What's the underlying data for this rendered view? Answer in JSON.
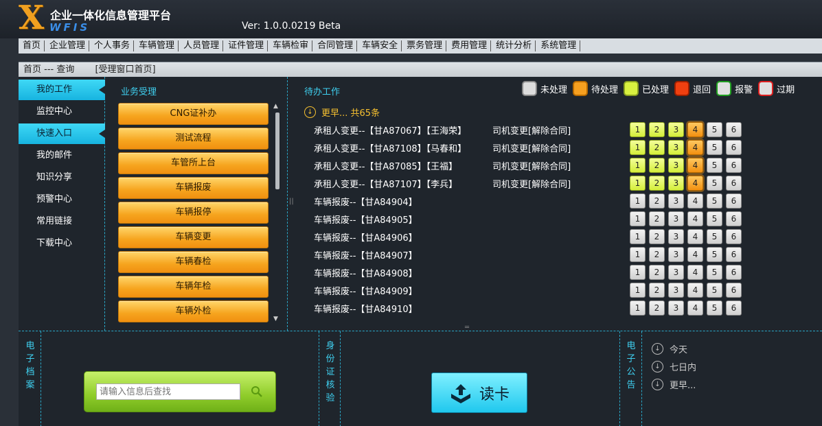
{
  "header": {
    "logo_main": "X",
    "logo_sub": "WFIS",
    "title": "企业一体化信息管理平台",
    "version": "Ver: 1.0.0.0219 Beta"
  },
  "nav": [
    "首页",
    "企业管理",
    "个人事务",
    "车辆管理",
    "人员管理",
    "证件管理",
    "车辆检审",
    "合同管理",
    "车辆安全",
    "票务管理",
    "费用管理",
    "统计分析",
    "系统管理"
  ],
  "breadcrumb": {
    "path": "首页 --- 查询",
    "current": "[受理窗口首页]"
  },
  "left_menu": [
    {
      "label": "我的工作",
      "active": true
    },
    {
      "label": "监控中心",
      "active": false
    },
    {
      "label": "快速入口",
      "active": true
    },
    {
      "label": "我的邮件",
      "active": false
    },
    {
      "label": "知识分享",
      "active": false
    },
    {
      "label": "预警中心",
      "active": false
    },
    {
      "label": "常用链接",
      "active": false
    },
    {
      "label": "下载中心",
      "active": false
    }
  ],
  "business": {
    "title": "业务受理",
    "items": [
      "CNG证补办",
      "测试流程",
      "车管所上台",
      "车辆报废",
      "车辆报停",
      "车辆变更",
      "车辆春检",
      "车辆年检",
      "车辆外检"
    ]
  },
  "todo": {
    "title": "待办工作",
    "legend": [
      {
        "label": "未处理",
        "color": "#dcdcdc",
        "border": "#888888"
      },
      {
        "label": "待处理",
        "color": "#f6a020",
        "border": "#b86a00"
      },
      {
        "label": "已处理",
        "color": "#d8f040",
        "border": "#8aa020"
      },
      {
        "label": "退回",
        "color": "#f04010",
        "border": "#a02000"
      },
      {
        "label": "报警",
        "color": "#e0e0e0",
        "border": "#20a020"
      },
      {
        "label": "过期",
        "color": "#e0e0e0",
        "border": "#e02020"
      }
    ],
    "more": "更早... 共65条",
    "rows": [
      {
        "text": "承租人变更--【甘A87067】【王海荣】",
        "type": "司机变更[解除合同]",
        "steps": [
          "done",
          "done",
          "done",
          "pending",
          "todo",
          "todo"
        ]
      },
      {
        "text": "承租人变更--【甘A87108】【马春和】",
        "type": "司机变更[解除合同]",
        "steps": [
          "done",
          "done",
          "done",
          "pending",
          "todo",
          "todo"
        ]
      },
      {
        "text": "承租人变更--【甘A87085】【王福】",
        "type": "司机变更[解除合同]",
        "steps": [
          "done",
          "done",
          "done",
          "pending",
          "todo",
          "todo"
        ]
      },
      {
        "text": "承租人变更--【甘A87107】【李兵】",
        "type": "司机变更[解除合同]",
        "steps": [
          "done",
          "done",
          "done",
          "pending",
          "todo",
          "todo"
        ]
      },
      {
        "text": "车辆报废--【甘A84904】",
        "type": "",
        "steps": [
          "todo",
          "todo",
          "todo",
          "todo",
          "todo",
          "todo"
        ]
      },
      {
        "text": "车辆报废--【甘A84905】",
        "type": "",
        "steps": [
          "todo",
          "todo",
          "todo",
          "todo",
          "todo",
          "todo"
        ]
      },
      {
        "text": "车辆报废--【甘A84906】",
        "type": "",
        "steps": [
          "todo",
          "todo",
          "todo",
          "todo",
          "todo",
          "todo"
        ]
      },
      {
        "text": "车辆报废--【甘A84907】",
        "type": "",
        "steps": [
          "todo",
          "todo",
          "todo",
          "todo",
          "todo",
          "todo"
        ]
      },
      {
        "text": "车辆报废--【甘A84908】",
        "type": "",
        "steps": [
          "todo",
          "todo",
          "todo",
          "todo",
          "todo",
          "todo"
        ]
      },
      {
        "text": "车辆报废--【甘A84909】",
        "type": "",
        "steps": [
          "todo",
          "todo",
          "todo",
          "todo",
          "todo",
          "todo"
        ]
      },
      {
        "text": "车辆报废--【甘A84910】",
        "type": "",
        "steps": [
          "todo",
          "todo",
          "todo",
          "todo",
          "todo",
          "todo"
        ]
      }
    ],
    "step_labels": [
      "1",
      "2",
      "3",
      "4",
      "5",
      "6"
    ]
  },
  "bottom": {
    "archive_label": "电子档案",
    "search_placeholder": "请输入信息后查找",
    "idcard_label": "身份证核验",
    "read_button": "读卡",
    "notice_label": "电子公告",
    "notices": [
      "今天",
      "七日内",
      "更早..."
    ]
  },
  "icons": {
    "more": "circle-down-arrow-icon",
    "search": "search-icon",
    "read": "upload-tray-icon",
    "scroll_up": "triangle-up-icon",
    "scroll_down": "triangle-down-icon"
  }
}
